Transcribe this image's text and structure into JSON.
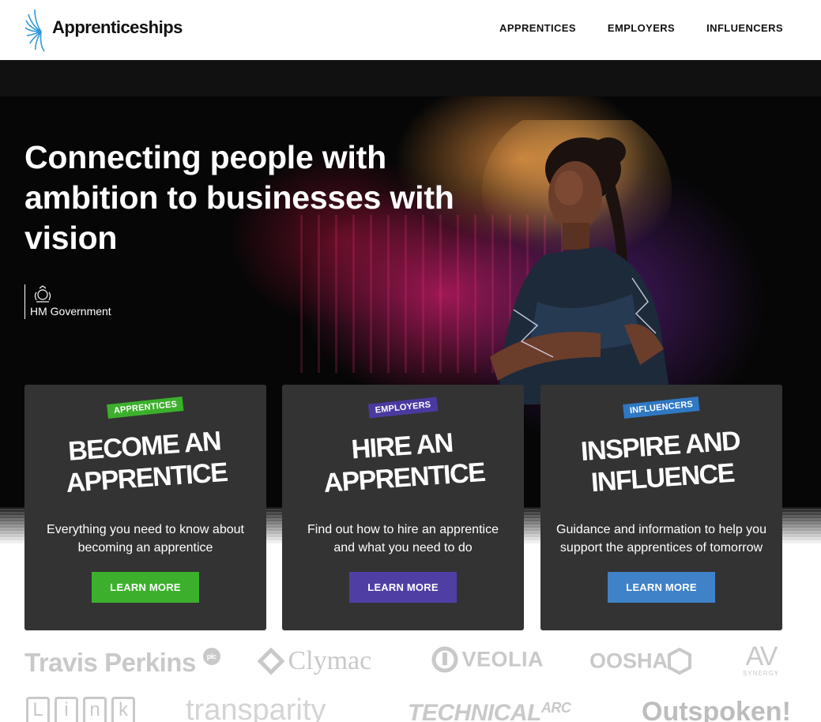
{
  "header": {
    "logo_text": "Apprenticeships",
    "nav": [
      "APPRENTICES",
      "EMPLOYERS",
      "INFLUENCERS"
    ]
  },
  "hero": {
    "title": "Connecting people with ambition to businesses with vision",
    "gov_label": "HM Government"
  },
  "cards": [
    {
      "tag": "APPRENTICES",
      "tag_color": "#3cb02c",
      "title_line1": "BECOME AN",
      "title_line2": "APPRENTICE",
      "description": "Everything you need to know about becoming an apprentice",
      "button": "LEARN MORE",
      "button_color": "#3cb02c"
    },
    {
      "tag": "EMPLOYERS",
      "tag_color": "#4a3aa0",
      "title_line1": "HIRE AN",
      "title_line2": "APPRENTICE",
      "description": "Find out how to hire an apprentice and what you need to do",
      "button": "LEARN MORE",
      "button_color": "#4f3fa5"
    },
    {
      "tag": "INFLUENCERS",
      "tag_color": "#2f78c4",
      "title_line1": "INSPIRE AND",
      "title_line2": "INFLUENCE",
      "description": "Guidance and information to help you support the apprentices of tomorrow",
      "button": "LEARN MORE",
      "button_color": "#3f82c8"
    }
  ],
  "partner_logos": {
    "travis": "Travis Perkins",
    "travis_plc": "plc",
    "clymac": "Clymac",
    "veolia": "VEOLIA",
    "oosha": "OOSHA",
    "av": "AV",
    "av_sub": "SYNERGY",
    "link": [
      "L",
      "i",
      "n",
      "k"
    ],
    "transparity": "transparity",
    "technical": "TECHNICAL",
    "technical_arc": "ARC",
    "outspoken": "Outspoken!"
  },
  "colors": {
    "header_bg": "#ffffff",
    "hero_bg": "#060606",
    "card_bg": "#333333",
    "logo_gray": "#c9c9c9"
  }
}
